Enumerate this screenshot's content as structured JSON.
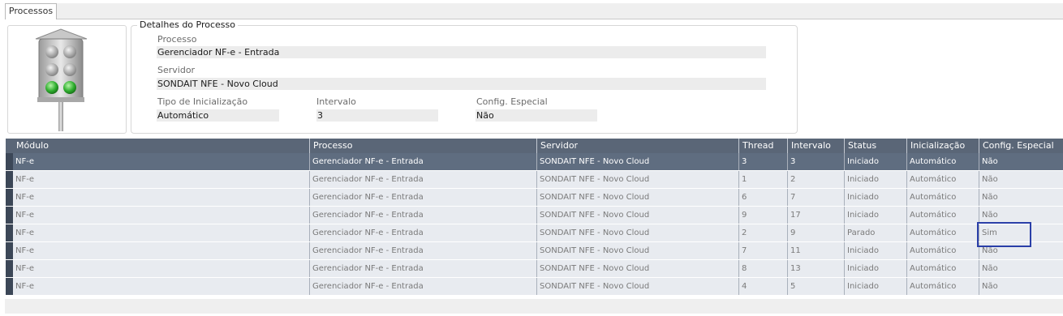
{
  "tabs": [
    {
      "label": "Processos"
    }
  ],
  "details": {
    "title": "Detalhes do Processo",
    "processo_label": "Processo",
    "processo_value": "Gerenciador NF-e - Entrada",
    "servidor_label": "Servidor",
    "servidor_value": "SONDAIT NFE - Novo Cloud",
    "tipo_label": "Tipo de Inicialização",
    "tipo_value": "Automático",
    "intervalo_label": "Intervalo",
    "intervalo_value": "3",
    "config_label": "Config. Especial",
    "config_value": "Não"
  },
  "traffic_light": {
    "active": "green"
  },
  "table": {
    "columns": [
      "Módulo",
      "Processo",
      "Servidor",
      "Thread",
      "Intervalo",
      "Status",
      "Inicialização",
      "Config. Especial"
    ],
    "rows": [
      [
        "NF-e",
        "Gerenciador NF-e - Entrada",
        "SONDAIT NFE - Novo Cloud",
        "3",
        "3",
        "Iniciado",
        "Automático",
        "Não"
      ],
      [
        "NF-e",
        "Gerenciador NF-e - Entrada",
        "SONDAIT NFE - Novo Cloud",
        "1",
        "2",
        "Iniciado",
        "Automático",
        "Não"
      ],
      [
        "NF-e",
        "Gerenciador NF-e - Entrada",
        "SONDAIT NFE - Novo Cloud",
        "6",
        "7",
        "Iniciado",
        "Automático",
        "Não"
      ],
      [
        "NF-e",
        "Gerenciador NF-e - Entrada",
        "SONDAIT NFE - Novo Cloud",
        "9",
        "17",
        "Iniciado",
        "Automático",
        "Não"
      ],
      [
        "NF-e",
        "Gerenciador NF-e - Entrada",
        "SONDAIT NFE - Novo Cloud",
        "2",
        "9",
        "Parado",
        "Automático",
        "Sim"
      ],
      [
        "NF-e",
        "Gerenciador NF-e - Entrada",
        "SONDAIT NFE - Novo Cloud",
        "7",
        "11",
        "Iniciado",
        "Automático",
        "Não"
      ],
      [
        "NF-e",
        "Gerenciador NF-e - Entrada",
        "SONDAIT NFE - Novo Cloud",
        "8",
        "13",
        "Iniciado",
        "Automático",
        "Não"
      ],
      [
        "NF-e",
        "Gerenciador NF-e - Entrada",
        "SONDAIT NFE - Novo Cloud",
        "4",
        "5",
        "Iniciado",
        "Automático",
        "Não"
      ]
    ],
    "selected_row": 0
  },
  "colors": {
    "header_bg": "#5a6677",
    "selected_row_bg": "#5f6d80",
    "highlight_border": "#2a3fa8",
    "light_green": "#2fae2f"
  }
}
